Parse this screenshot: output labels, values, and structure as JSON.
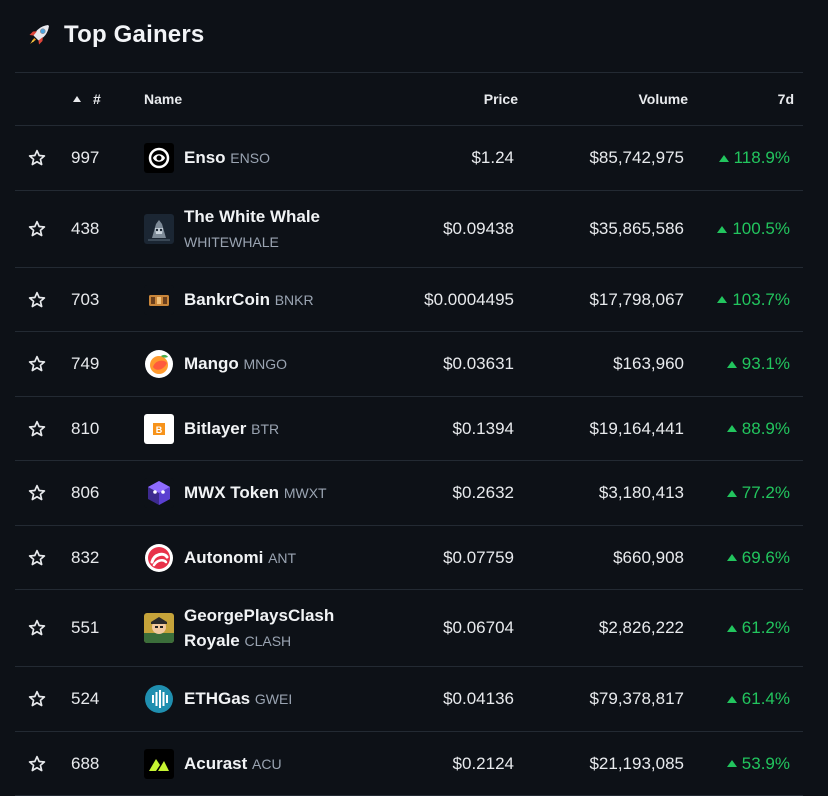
{
  "title": "Top Gainers",
  "header_icon": "rocket-icon",
  "columns": {
    "rank": "#",
    "name": "Name",
    "price": "Price",
    "volume": "Volume",
    "change": "7d"
  },
  "sort": {
    "column": "rank",
    "direction": "ascending"
  },
  "colors": {
    "background": "#0d1117",
    "positive": "#22c55e",
    "muted": "#9aa4b2"
  },
  "rows": [
    {
      "rank": "997",
      "name": "Enso",
      "symbol": "ENSO",
      "price": "$1.24",
      "volume": "$85,742,975",
      "change": "118.9%",
      "logo": "enso-logo"
    },
    {
      "rank": "438",
      "name": "The White Whale",
      "symbol": "WHITEWHALE",
      "price": "$0.09438",
      "volume": "$35,865,586",
      "change": "100.5%",
      "logo": "whitewhale-logo"
    },
    {
      "rank": "703",
      "name": "BankrCoin",
      "symbol": "BNKR",
      "price": "$0.0004495",
      "volume": "$17,798,067",
      "change": "103.7%",
      "logo": "bankrcoin-logo"
    },
    {
      "rank": "749",
      "name": "Mango",
      "symbol": "MNGO",
      "price": "$0.03631",
      "volume": "$163,960",
      "change": "93.1%",
      "logo": "mango-logo"
    },
    {
      "rank": "810",
      "name": "Bitlayer",
      "symbol": "BTR",
      "price": "$0.1394",
      "volume": "$19,164,441",
      "change": "88.9%",
      "logo": "bitlayer-logo"
    },
    {
      "rank": "806",
      "name": "MWX Token",
      "symbol": "MWXT",
      "price": "$0.2632",
      "volume": "$3,180,413",
      "change": "77.2%",
      "logo": "mwx-logo"
    },
    {
      "rank": "832",
      "name": "Autonomi",
      "symbol": "ANT",
      "price": "$0.07759",
      "volume": "$660,908",
      "change": "69.6%",
      "logo": "autonomi-logo"
    },
    {
      "rank": "551",
      "name": "GeorgePlaysClash Royale",
      "symbol": "CLASH",
      "price": "$0.06704",
      "volume": "$2,826,222",
      "change": "61.2%",
      "logo": "clash-logo"
    },
    {
      "rank": "524",
      "name": "ETHGas",
      "symbol": "GWEI",
      "price": "$0.04136",
      "volume": "$79,378,817",
      "change": "61.4%",
      "logo": "ethgas-logo"
    },
    {
      "rank": "688",
      "name": "Acurast",
      "symbol": "ACU",
      "price": "$0.2124",
      "volume": "$21,193,085",
      "change": "53.9%",
      "logo": "acurast-logo"
    }
  ]
}
